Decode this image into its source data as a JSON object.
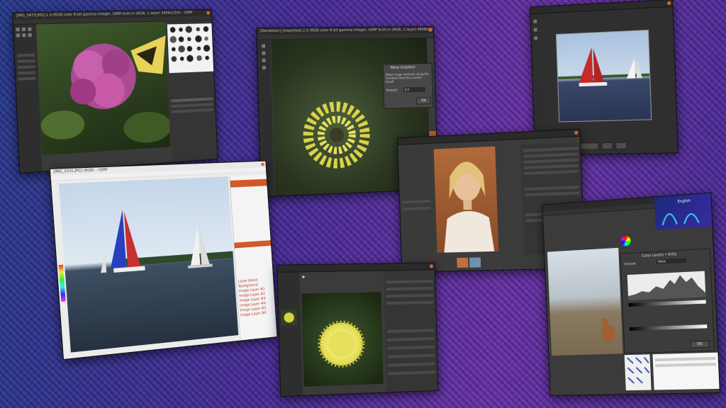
{
  "window_titles": {
    "w1": "[IMG_3473.JPG]-1.0 (RGB color 8-bit gamma integer, GIMP built-in sRGB, 1 layer) 3456x2304 – GIMP",
    "w2": "[Dandelion] (imported)-2.0 (RGB color 8-bit gamma integer, GIMP built-in sRGB, 1 layer) 4608x3072 – GIMP",
    "w4": "[IMG_3331.JPG] (RGB) – GIMP"
  },
  "dialog": {
    "title": "Warp Gradient",
    "text": "Warp image contents using the Gradient from the current brush",
    "field_label": "Amount",
    "field_value": "0.5",
    "ok_label": "OK"
  },
  "layers_panel": {
    "items": [
      "Layer blend",
      "Background",
      "Image Layer #1",
      "Image Layer #2",
      "Image Layer #3",
      "Image Layer #4",
      "Image Layer #5",
      "Image Layer #6"
    ]
  },
  "levels_dialog": {
    "title": "Color Levels • Krita",
    "channel_label": "Channel",
    "channel_value": "Value",
    "ok_label": "OK"
  },
  "krita_header": {
    "label": "English"
  },
  "colors": {
    "accent": "#e2662c",
    "panel_dark": "#2e2e2e",
    "bg_purple": "#4b2f9a"
  }
}
